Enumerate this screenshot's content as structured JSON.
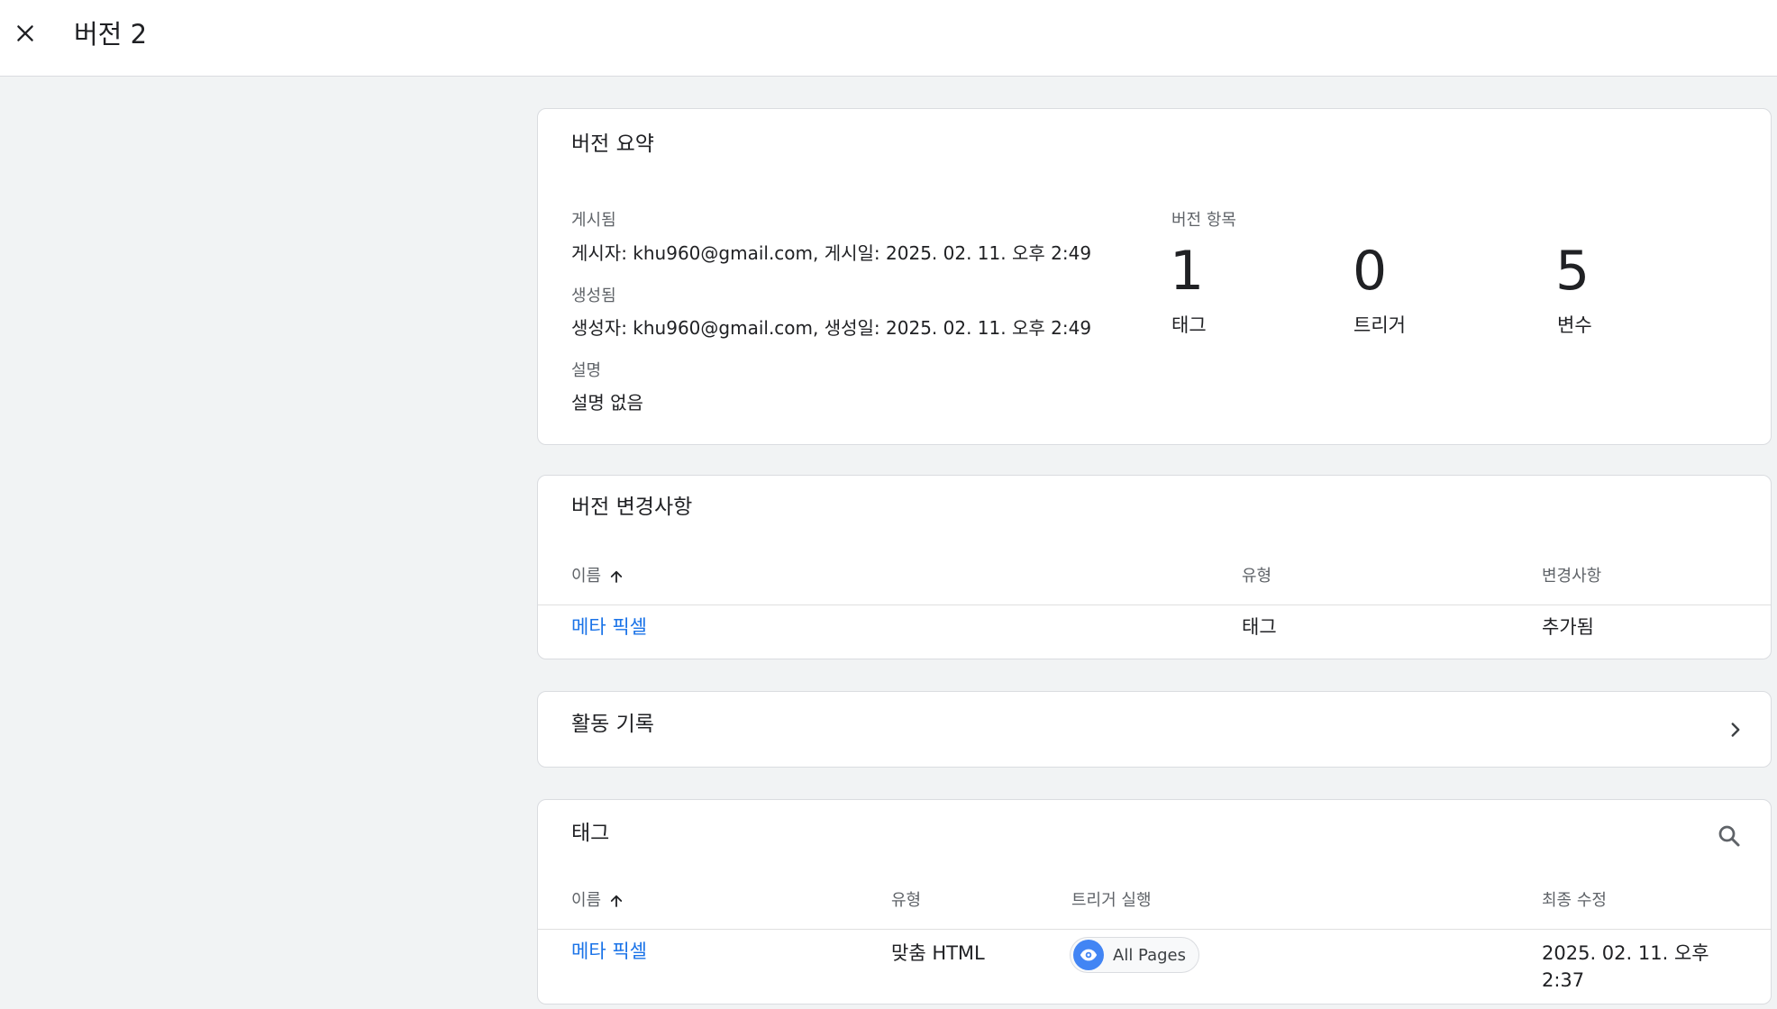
{
  "header": {
    "title": "버전 2"
  },
  "summary": {
    "title": "버전 요약",
    "published_label": "게시됨",
    "published_value": "게시자: khu960@gmail.com, 게시일: 2025. 02. 11. 오후 2:49",
    "created_label": "생성됨",
    "created_value": "생성자: khu960@gmail.com, 생성일: 2025. 02. 11. 오후 2:49",
    "description_label": "설명",
    "description_value": "설명 없음",
    "items_label": "버전 항목",
    "counts": [
      {
        "value": "1",
        "label": "태그"
      },
      {
        "value": "0",
        "label": "트리거"
      },
      {
        "value": "5",
        "label": "변수"
      }
    ]
  },
  "changes": {
    "title": "버전 변경사항",
    "columns": {
      "name": "이름",
      "type": "유형",
      "change": "변경사항"
    },
    "rows": [
      {
        "name": "메타 픽셀",
        "type": "태그",
        "change": "추가됨"
      }
    ]
  },
  "activity": {
    "title": "활동 기록"
  },
  "tags": {
    "title": "태그",
    "columns": {
      "name": "이름",
      "type": "유형",
      "trigger": "트리거 실행",
      "modified": "최종 수정"
    },
    "rows": [
      {
        "name": "메타 픽셀",
        "type": "맞춤 HTML",
        "trigger": "All Pages",
        "modified_line1": "2025. 02. 11. 오후",
        "modified_line2": "2:37"
      }
    ]
  },
  "icons": {
    "close": "close-icon",
    "sort": "arrow-up-icon",
    "chevron": "chevron-right-icon",
    "search": "search-icon",
    "trigger": "eye-icon"
  },
  "colors": {
    "link": "#1a73e8",
    "chip_icon": "#4285f4",
    "background": "#f1f3f4"
  }
}
